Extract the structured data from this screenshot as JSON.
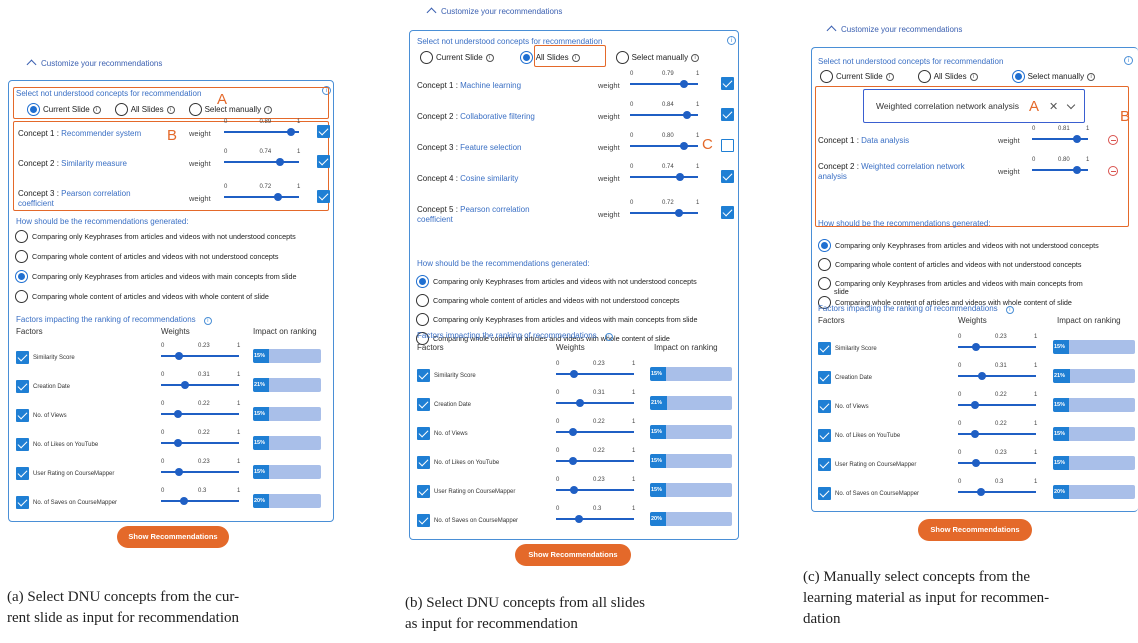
{
  "toggle_label": "Customize your recommendations",
  "section_titles": {
    "select": "Select not understood concepts for recommendation",
    "how": "How should be the recommendations generated:",
    "factors": "Factors impacting the ranking of recommendations"
  },
  "scope_options": [
    "Current Slide",
    "All Slides",
    "Select manually"
  ],
  "weight_label": "weight",
  "slider_min": "0",
  "slider_max": "1",
  "factor_headers": {
    "factors": "Factors",
    "weights": "Weights",
    "impact": "Impact on ranking"
  },
  "show_button": "Show Recommendations",
  "methods_a": [
    "Comparing only Keyphrases from articles and videos with not understood concepts",
    "Comparing whole content of articles and videos with not understood concepts",
    "Comparing only Keyphrases from articles and videos with main concepts from slide",
    "Comparing whole content of articles and videos with whole content of slide"
  ],
  "methods_c": [
    "Comparing only Keyphrases from articles and videos with not understood concepts",
    "Comparing whole content of articles and videos with not understood concepts",
    "Comparing only Keyphrases from articles and videos with main concepts from",
    "slide",
    "Comparing whole content of articles and videos with whole content of slide"
  ],
  "factors": [
    {
      "name": "Similarity Score",
      "weight": "0.23",
      "weight_value": 0.23,
      "impact": "15%",
      "impact_value": 15
    },
    {
      "name": "Creation Date",
      "weight": "0.31",
      "weight_value": 0.31,
      "impact": "21%",
      "impact_value": 21
    },
    {
      "name": "No. of Views",
      "weight": "0.22",
      "weight_value": 0.22,
      "impact": "15%",
      "impact_value": 15
    },
    {
      "name": "No. of Likes on YouTube",
      "weight": "0.22",
      "weight_value": 0.22,
      "impact": "15%",
      "impact_value": 15
    },
    {
      "name": "User Rating on CourseMapper",
      "weight": "0.23",
      "weight_value": 0.23,
      "impact": "15%",
      "impact_value": 15
    },
    {
      "name": "No. of Saves on CourseMapper",
      "weight": "0.3",
      "weight_value": 0.3,
      "impact": "20%",
      "impact_value": 20
    }
  ],
  "panel_a": {
    "selected": 0,
    "method_selected": 2,
    "concepts": [
      {
        "prefix": "Concept 1 : ",
        "name": "Recommender system",
        "weight": "0.89",
        "weight_value": 0.89
      },
      {
        "prefix": "Concept 2 : ",
        "name": "Similarity measure",
        "weight": "0.74",
        "weight_value": 0.74
      },
      {
        "prefix": "Concept 3 : ",
        "name": "Pearson correlation",
        "name2": "coefficient",
        "weight": "0.72",
        "weight_value": 0.72
      }
    ],
    "letters": [
      "A",
      "B"
    ],
    "caption": [
      "(a) Select DNU concepts from the cur-",
      "rent slide as input for recommendation"
    ]
  },
  "panel_b": {
    "selected": 1,
    "method_selected": 0,
    "concepts": [
      {
        "prefix": "Concept 1 : ",
        "name": "Machine learning",
        "weight": "0.79",
        "weight_value": 0.79,
        "checked": true
      },
      {
        "prefix": "Concept 2 : ",
        "name": "Collaborative filtering",
        "weight": "0.84",
        "weight_value": 0.84,
        "checked": true
      },
      {
        "prefix": "Concept 3 : ",
        "name": "Feature selection",
        "weight": "0.80",
        "weight_value": 0.8,
        "checked": false
      },
      {
        "prefix": "Concept 4 : ",
        "name": "Cosine similarity",
        "weight": "0.74",
        "weight_value": 0.74,
        "checked": true
      },
      {
        "prefix": "Concept 5 : ",
        "name": "Pearson correlation",
        "name2": "coefficient",
        "weight": "0.72",
        "weight_value": 0.72,
        "checked": true
      }
    ],
    "letters": [
      "C"
    ],
    "caption": [
      "(b) Select DNU concepts from all slides",
      "as input for recommendation"
    ]
  },
  "panel_c": {
    "selected": 2,
    "method_selected": 0,
    "select_value": "Weighted correlation network analysis",
    "concepts": [
      {
        "prefix": "Concept 1 : ",
        "name": "Data analysis",
        "weight": "0.81",
        "weight_value": 0.81
      },
      {
        "prefix": "Concept 2 : ",
        "name": "Weighted correlation network",
        "name2": "analysis",
        "weight": "0.80",
        "weight_value": 0.8
      }
    ],
    "letters": [
      "A",
      "B"
    ],
    "caption": [
      "(c) Manually select concepts from the",
      "learning material as input for recommen-",
      "dation"
    ]
  },
  "info_glyph": "i"
}
